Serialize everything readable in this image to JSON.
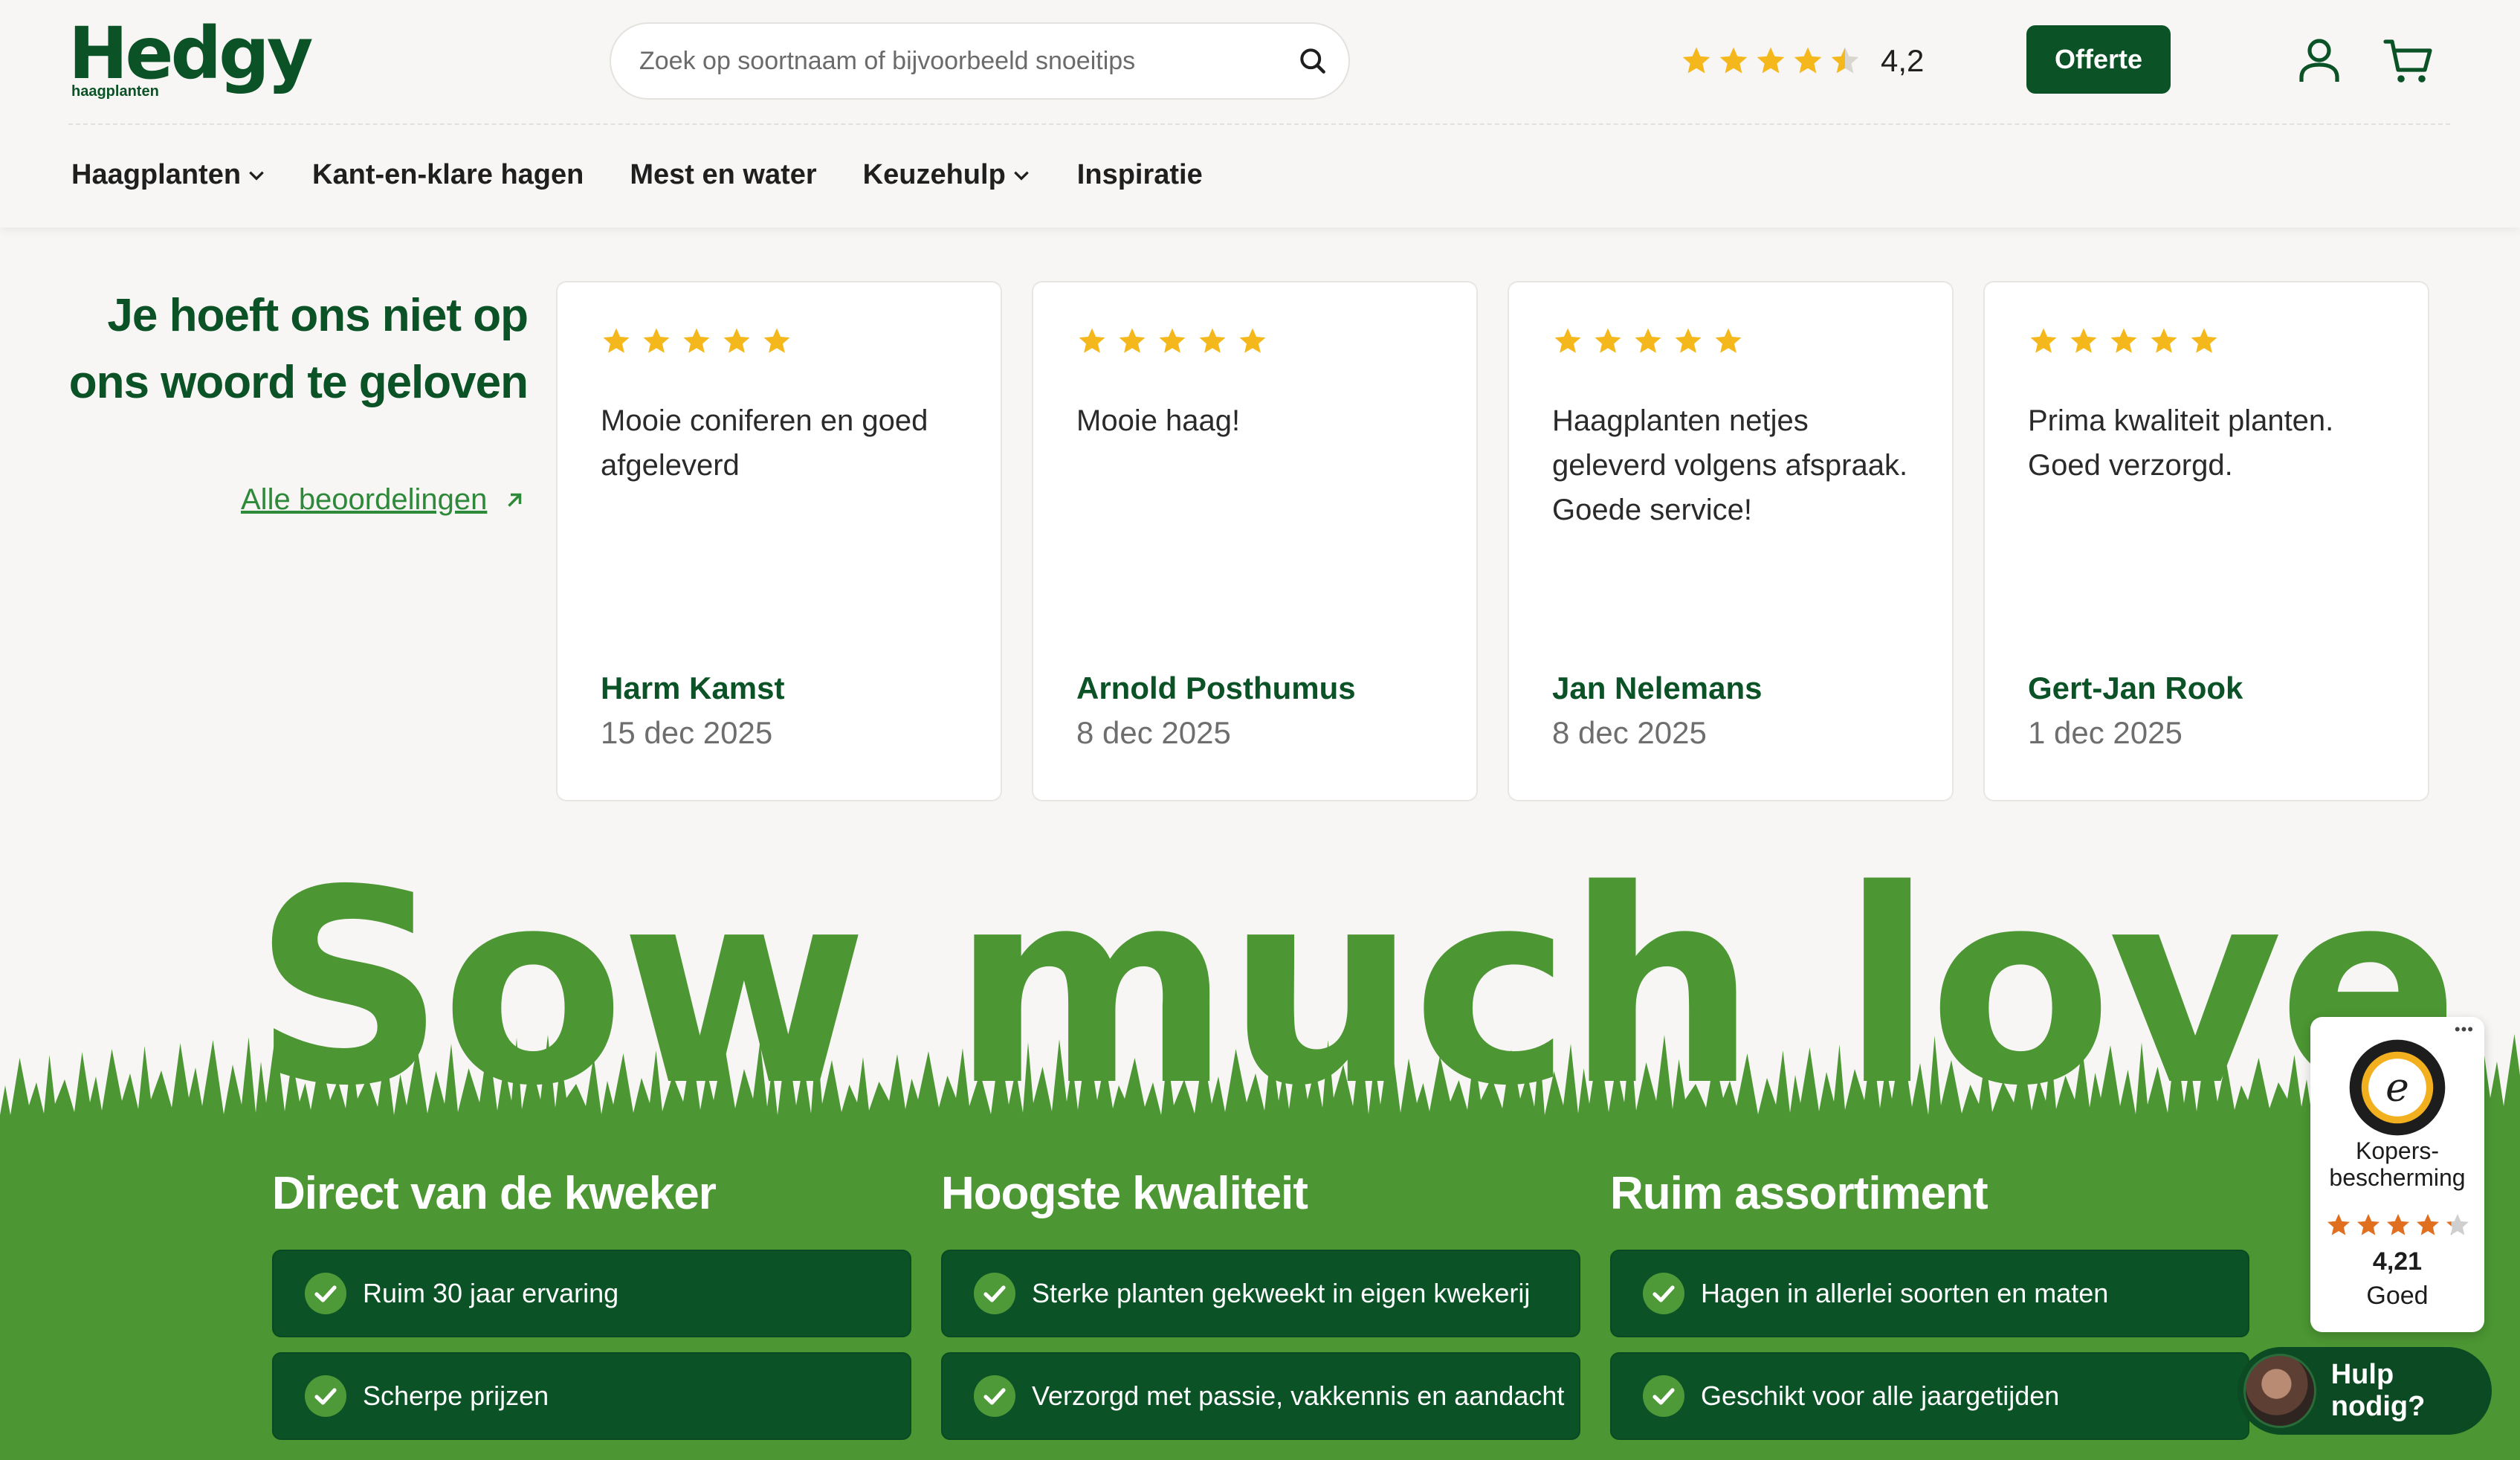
{
  "brand": {
    "name": "Hedgy",
    "subtitle": "haagplanten"
  },
  "search": {
    "placeholder": "Zoek op soortnaam of bijvoorbeeld snoeitips"
  },
  "rating": {
    "value": "4,2",
    "stars": 4.5
  },
  "header": {
    "offerte_label": "Offerte"
  },
  "nav": [
    {
      "label": "Haagplanten",
      "has_dropdown": true
    },
    {
      "label": "Kant-en-klare hagen",
      "has_dropdown": false
    },
    {
      "label": "Mest en water",
      "has_dropdown": false
    },
    {
      "label": "Keuzehulp",
      "has_dropdown": true
    },
    {
      "label": "Inspiratie",
      "has_dropdown": false
    }
  ],
  "reviews": {
    "title": "Je hoeft ons niet op ons woord te geloven",
    "all_link": "Alle beoordelingen",
    "items": [
      {
        "stars": 5,
        "text": "Mooie coniferen en goed afgeleverd",
        "name": "Harm Kamst",
        "date": "15 dec 2025"
      },
      {
        "stars": 5,
        "text": "Mooie haag!",
        "name": "Arnold Posthumus",
        "date": "8 dec 2025"
      },
      {
        "stars": 5,
        "text": "Haagplanten netjes geleverd volgens afspraak. Goede service!",
        "name": "Jan Nelemans",
        "date": "8 dec 2025"
      },
      {
        "stars": 5,
        "text": "Prima kwaliteit planten. Goed verzorgd.",
        "name": "Gert-Jan Rook",
        "date": "1 dec 2025"
      }
    ]
  },
  "slogan": "Sow much love",
  "usps": [
    {
      "title": "Direct van de kweker",
      "items": [
        "Ruim 30 jaar ervaring",
        "Scherpe prijzen"
      ]
    },
    {
      "title": "Hoogste kwaliteit",
      "items": [
        "Sterke planten gekweekt in eigen kwekerij",
        "Verzorgd met passie, vakkennis en aandacht"
      ]
    },
    {
      "title": "Ruim assortiment",
      "items": [
        "Hagen in allerlei soorten en maten",
        "Geschikt voor alle jaargetijden"
      ]
    }
  ],
  "trusted_shops": {
    "label": "Kopers-bescherming",
    "score": "4,21",
    "grade": "Goed",
    "stars": 4.21
  },
  "help": {
    "label": "Hulp nodig?"
  },
  "colors": {
    "dark_green": "#0b5226",
    "grass_green": "#4c9633",
    "star_yellow": "#f5b81c",
    "link_green": "#2e8a3a",
    "ts_star": "#e06f1f"
  },
  "icons": [
    "search-icon",
    "user-icon",
    "cart-icon",
    "chevron-down-icon",
    "arrow-up-right-icon",
    "check-circle-icon",
    "star-icon",
    "trusted-shops-seal-icon"
  ]
}
